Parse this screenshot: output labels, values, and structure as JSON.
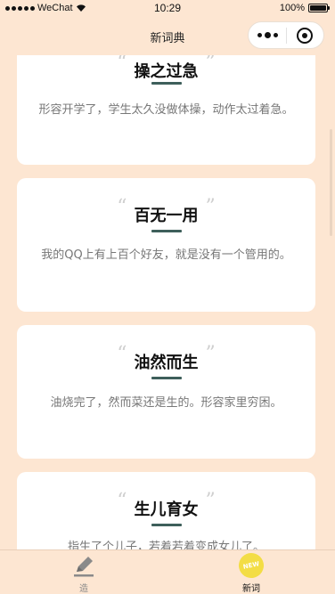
{
  "status": {
    "carrier": "WeChat",
    "time": "10:29",
    "battery": "100%"
  },
  "nav": {
    "title": "新词典"
  },
  "cards": [
    {
      "word": "操之过急",
      "explain": "形容开学了，学生太久没做体操，动作太过着急。"
    },
    {
      "word": "百无一用",
      "explain": "我的QQ上有上百个好友，就是没有一个管用的。"
    },
    {
      "word": "油然而生",
      "explain": "油烧完了，然而菜还是生的。形容家里穷困。"
    },
    {
      "word": "生儿育女",
      "explain": "指生了个儿子，若着若着变成女儿了。"
    }
  ],
  "quote_open": "“",
  "quote_close": "”",
  "tabs": [
    {
      "label": "造",
      "icon": "pencil-icon",
      "active": false
    },
    {
      "label": "新词",
      "icon": "new-badge-icon",
      "active": true,
      "badge": "NEW"
    }
  ],
  "colors": {
    "background": "#fde6d2",
    "accent": "#3e5f5b",
    "badge": "#f3dd45"
  }
}
